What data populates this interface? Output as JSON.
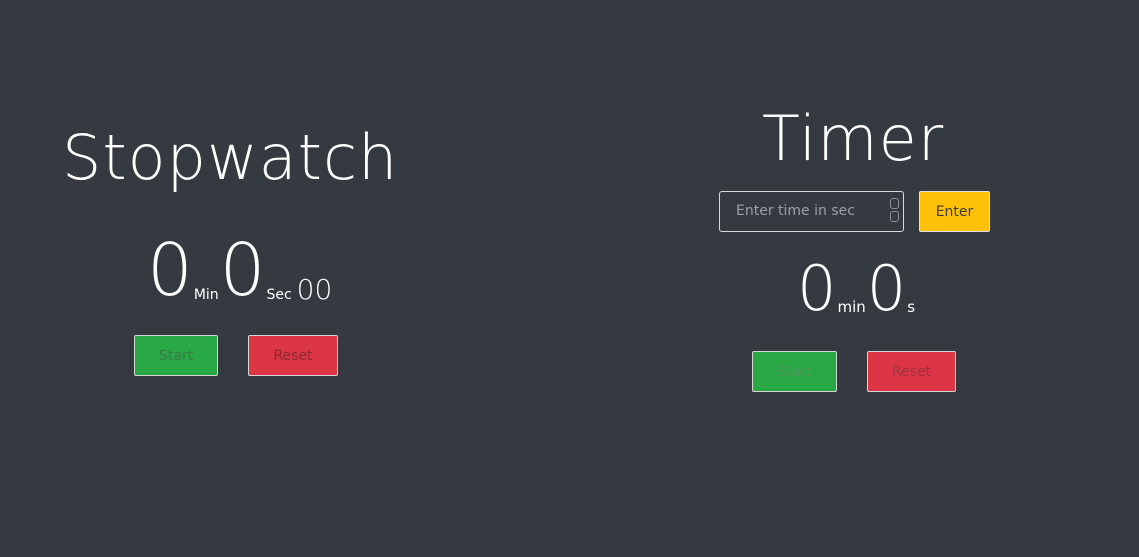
{
  "stopwatch": {
    "title": "Stopwatch",
    "minutes": "0",
    "min_unit": "Min",
    "seconds": "0",
    "sec_unit": "Sec",
    "centiseconds": "00",
    "start_label": "Start",
    "reset_label": "Reset"
  },
  "timer": {
    "title": "Timer",
    "input_placeholder": "Enter time in sec",
    "enter_label": "Enter",
    "minutes": "0",
    "min_unit": "min",
    "seconds": "0",
    "sec_unit": "s",
    "start_label": "Start",
    "reset_label": "Reset"
  },
  "colors": {
    "background": "#343a40",
    "start": "#28a745",
    "reset": "#dc3545",
    "enter": "#ffc107"
  }
}
